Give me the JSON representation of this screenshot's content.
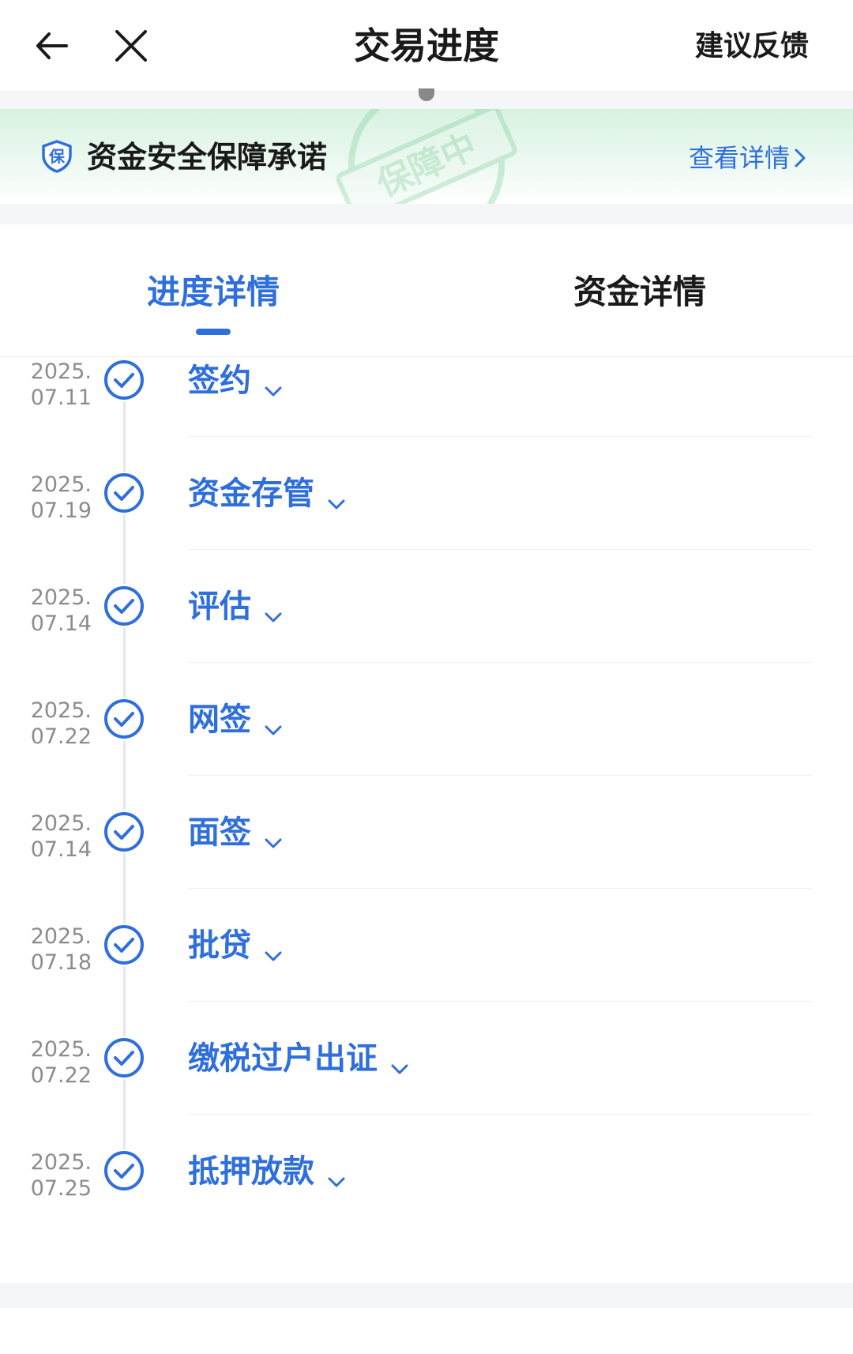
{
  "header": {
    "title": "交易进度",
    "feedback_label": "建议反馈"
  },
  "banner": {
    "shield_char": "保",
    "title": "资金安全保障承诺",
    "link_label": "查看详情",
    "stamp_text": "保障中",
    "accent_color": "#2f6fdb"
  },
  "tabs": [
    {
      "label": "进度详情",
      "active": true
    },
    {
      "label": "资金详情",
      "active": false
    }
  ],
  "timeline": [
    {
      "date": "2025.07.11",
      "label": "签约"
    },
    {
      "date": "2025.07.19",
      "label": "资金存管"
    },
    {
      "date": "2025.07.14",
      "label": "评估"
    },
    {
      "date": "2025.07.22",
      "label": "网签"
    },
    {
      "date": "2025.07.14",
      "label": "面签"
    },
    {
      "date": "2025.07.18",
      "label": "批贷"
    },
    {
      "date": "2025.07.22",
      "label": "缴税过户出证"
    },
    {
      "date": "2025.07.25",
      "label": "抵押放款"
    }
  ]
}
